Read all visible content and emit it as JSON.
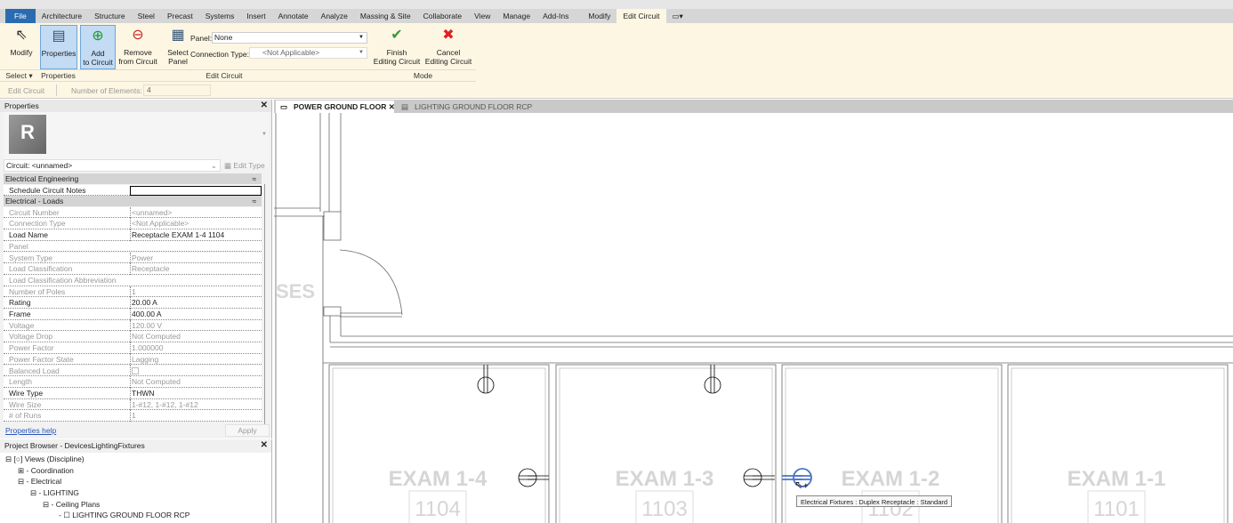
{
  "ribbon": {
    "tabs": [
      "File",
      "Architecture",
      "Structure",
      "Steel",
      "Precast",
      "Systems",
      "Insert",
      "Annotate",
      "Analyze",
      "Massing & Site",
      "Collaborate",
      "View",
      "Manage",
      "Add-Ins",
      "Modify",
      "Edit Circuit"
    ],
    "active_tab": "Edit Circuit",
    "modify": "Modify",
    "properties": "Properties",
    "add_to_circuit": [
      "Add",
      "to Circuit"
    ],
    "remove_from_circuit": [
      "Remove",
      "from Circuit"
    ],
    "select_panel": [
      "Select",
      "Panel"
    ],
    "panel_label": "Panel:",
    "panel_value": "None",
    "connection_type_label": "Connection Type:",
    "connection_type_value": "<Not Applicable>",
    "finish": [
      "Finish",
      "Editing Circuit"
    ],
    "cancel": [
      "Cancel",
      "Editing Circuit"
    ],
    "panels": {
      "select": "Select",
      "properties": "Properties",
      "edit_circuit": "Edit Circuit",
      "mode": "Mode"
    }
  },
  "options_bar": {
    "context": "Edit Circuit",
    "elements_label": "Number of Elements:",
    "elements_value": "4"
  },
  "properties": {
    "title": "Properties",
    "type_selector": "Circuit: <unnamed>",
    "edit_type": "Edit Type",
    "sections": [
      {
        "name": "Electrical Engineering",
        "rows": [
          {
            "label": "Schedule Circuit Notes",
            "value": "",
            "editable": true
          }
        ]
      },
      {
        "name": "Electrical - Loads",
        "rows": [
          {
            "label": "Circuit Number",
            "value": "<unnamed>",
            "editable": false
          },
          {
            "label": "Connection Type",
            "value": "<Not Applicable>",
            "editable": false
          },
          {
            "label": "Load Name",
            "value": "Receptacle EXAM 1-4 1104",
            "editable": true
          },
          {
            "label": "Panel",
            "value": "",
            "editable": false
          },
          {
            "label": "System Type",
            "value": "Power",
            "editable": false
          },
          {
            "label": "Load Classification",
            "value": "Receptacle",
            "editable": false
          },
          {
            "label": "Load Classification Abbreviation",
            "value": "",
            "editable": false
          },
          {
            "label": "Number of Poles",
            "value": "1",
            "editable": false
          },
          {
            "label": "Rating",
            "value": "20.00 A",
            "editable": true
          },
          {
            "label": "Frame",
            "value": "400.00 A",
            "editable": true
          },
          {
            "label": "Voltage",
            "value": "120.00 V",
            "editable": false
          },
          {
            "label": "Voltage Drop",
            "value": "Not Computed",
            "editable": false
          },
          {
            "label": "Power Factor",
            "value": "1.000000",
            "editable": false
          },
          {
            "label": "Power Factor State",
            "value": "Lagging",
            "editable": false
          },
          {
            "label": "Balanced Load",
            "value": "",
            "editable": false
          },
          {
            "label": "Length",
            "value": "Not Computed",
            "editable": false
          },
          {
            "label": "Wire Type",
            "value": "THWN",
            "editable": true
          },
          {
            "label": "Wire Size",
            "value": "1-#12, 1-#12, 1-#12",
            "editable": false
          },
          {
            "label": "# of Runs",
            "value": "1",
            "editable": false
          }
        ]
      }
    ],
    "help": "Properties help",
    "apply": "Apply"
  },
  "project_browser": {
    "title": "Project Browser - DevicesLightingFixtures",
    "items": [
      "Views (Discipline)",
      "Coordination",
      "Electrical",
      "LIGHTING",
      "Ceiling Plans",
      "LIGHTING GROUND FLOOR RCP"
    ]
  },
  "view_tabs": [
    {
      "label": "POWER GROUND FLOOR",
      "active": true
    },
    {
      "label": "LIGHTING GROUND FLOOR RCP",
      "active": false
    }
  ],
  "canvas": {
    "partial_room_text": "SES",
    "rooms": [
      {
        "name": "EXAM 1-4",
        "number": "1104"
      },
      {
        "name": "EXAM 1-3",
        "number": "1103"
      },
      {
        "name": "EXAM 1-2",
        "number": "1102"
      },
      {
        "name": "EXAM 1-1",
        "number": "1101"
      }
    ],
    "tooltip": "Electrical Fixtures : Duplex Receptacle : Standard",
    "highlight_color": "#4a74c9"
  }
}
